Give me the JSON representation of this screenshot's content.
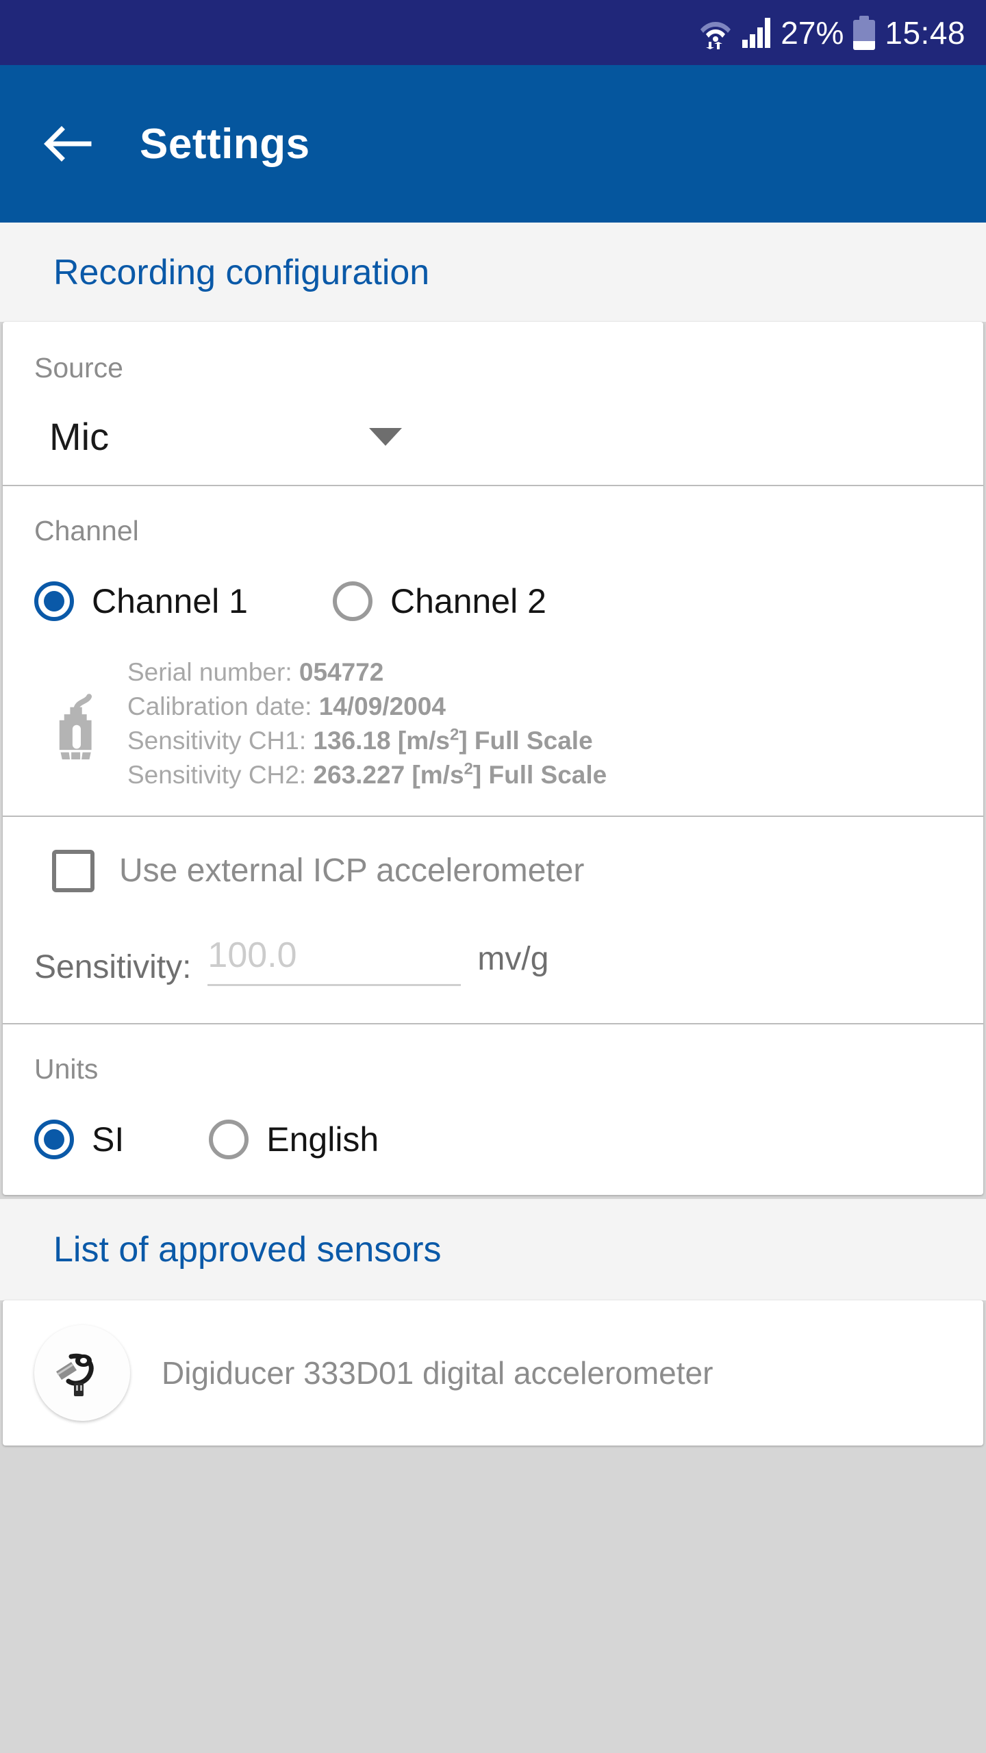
{
  "status_bar": {
    "wifi_icon": "wifi-icon",
    "signal_icon": "signal-icon",
    "battery_percent": "27%",
    "battery_icon": "battery-icon",
    "time": "15:48"
  },
  "app_bar": {
    "back_icon": "back-arrow-icon",
    "title": "Settings"
  },
  "sections": {
    "recording_configuration": {
      "header": "Recording configuration",
      "source": {
        "label": "Source",
        "value": "Mic",
        "caret_icon": "chevron-down-icon"
      },
      "channel": {
        "label": "Channel",
        "options": [
          {
            "label": "Channel 1",
            "selected": true
          },
          {
            "label": "Channel 2",
            "selected": false
          }
        ],
        "sensor_icon": "accelerometer-icon",
        "details": [
          {
            "label": "Serial number:",
            "value": "054772"
          },
          {
            "label": "Calibration date:",
            "value": "14/09/2004"
          },
          {
            "label": "Sensitivity CH1:",
            "value": "136.18 [m/s2] Full Scale"
          },
          {
            "label": "Sensitivity CH2:",
            "value": "263.227 [m/s2] Full Scale"
          }
        ],
        "details_plain": {
          "serial_label": "Serial number:",
          "serial_value": "054772",
          "calib_label": "Calibration date:",
          "calib_value": "14/09/2004",
          "ch1_label": "Sensitivity CH1:",
          "ch1_number": "136.18 [m/s",
          "ch1_sup": "2",
          "ch1_tail": "] Full Scale",
          "ch2_label": "Sensitivity CH2:",
          "ch2_number": "263.227 [m/s",
          "ch2_sup": "2",
          "ch2_tail": "] Full Scale"
        }
      },
      "external_icp": {
        "label": "Use external ICP accelerometer",
        "checked": false
      },
      "sensitivity": {
        "label": "Sensitivity:",
        "placeholder": "100.0",
        "value": "",
        "unit": "mv/g"
      },
      "units": {
        "label": "Units",
        "options": [
          {
            "label": "SI",
            "selected": true
          },
          {
            "label": "English",
            "selected": false
          }
        ]
      }
    },
    "approved_sensors": {
      "header": "List of approved sensors",
      "items": [
        {
          "thumb_icon": "usb-accelerometer-photo",
          "name": "Digiducer 333D01 digital accelerometer"
        }
      ]
    }
  },
  "colors": {
    "status_bar": "#20277a",
    "app_bar": "#05569e",
    "header_text": "#0a59a8",
    "accent": "#0a59a8",
    "page_bg": "#d6d6d6",
    "band_bg": "#f4f4f4",
    "card_bg": "#ffffff"
  }
}
